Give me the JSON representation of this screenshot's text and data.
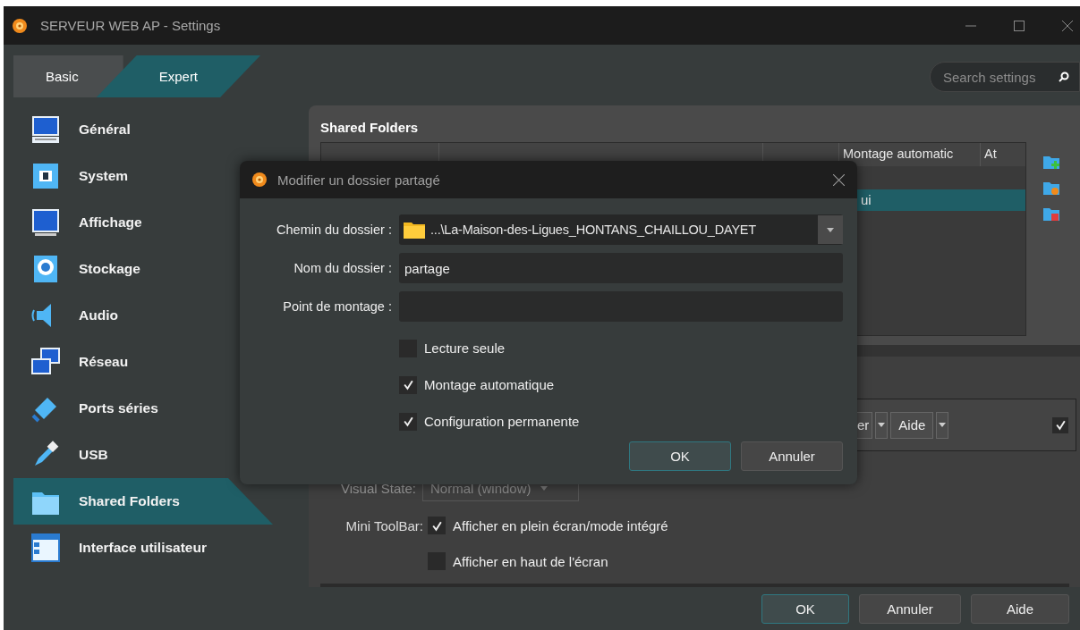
{
  "window": {
    "title": "SERVEUR WEB AP - Settings"
  },
  "mode_tabs": [
    {
      "label": "Basic",
      "selected": false
    },
    {
      "label": "Expert",
      "selected": true
    }
  ],
  "search": {
    "placeholder": "Search settings"
  },
  "sidebar": {
    "items": [
      {
        "label": "Général",
        "selected": false
      },
      {
        "label": "System",
        "selected": false
      },
      {
        "label": "Affichage",
        "selected": false
      },
      {
        "label": "Stockage",
        "selected": false
      },
      {
        "label": "Audio",
        "selected": false
      },
      {
        "label": "Réseau",
        "selected": false
      },
      {
        "label": "Ports séries",
        "selected": false
      },
      {
        "label": "USB",
        "selected": false
      },
      {
        "label": "Shared Folders",
        "selected": true
      },
      {
        "label": "Interface utilisateur",
        "selected": false
      }
    ]
  },
  "panel": {
    "title": "Shared Folders",
    "table": {
      "visible_columns": [
        "Montage automatic",
        "At"
      ],
      "rows": [
        {
          "selected": false
        },
        {
          "selected": true,
          "column_4": "ui"
        }
      ]
    }
  },
  "toolbar_group": {
    "buttons": [
      "er",
      "Aide"
    ],
    "checked": true
  },
  "visual_state": {
    "label": "Visual State:",
    "value": "Normal (window)"
  },
  "mini_toolbar": {
    "label": "Mini ToolBar:",
    "options": [
      {
        "label": "Afficher en plein écran/mode intégré",
        "checked": true
      },
      {
        "label": "Afficher en haut de l'écran",
        "checked": false
      }
    ]
  },
  "buttons": [
    {
      "label": "OK",
      "default": true
    },
    {
      "label": "Annuler",
      "default": false
    },
    {
      "label": "Aide",
      "default": false
    }
  ],
  "dialog": {
    "title": "Modifier un dossier partagé",
    "fields": [
      {
        "label": "Chemin du dossier :",
        "kind": "path",
        "value": "...\\La-Maison-des-Ligues_HONTANS_CHAILLOU_DAYET"
      },
      {
        "label": "Nom du dossier :",
        "kind": "text",
        "value": "partage"
      },
      {
        "label": "Point de montage :",
        "kind": "text"
      }
    ],
    "checkboxes": [
      {
        "label": "Lecture seule",
        "checked": false
      },
      {
        "label": "Montage automatique",
        "checked": true
      },
      {
        "label": "Configuration permanente",
        "checked": true
      }
    ],
    "buttons": [
      {
        "label": "OK",
        "default": true
      },
      {
        "label": "Annuler",
        "default": false
      }
    ]
  }
}
